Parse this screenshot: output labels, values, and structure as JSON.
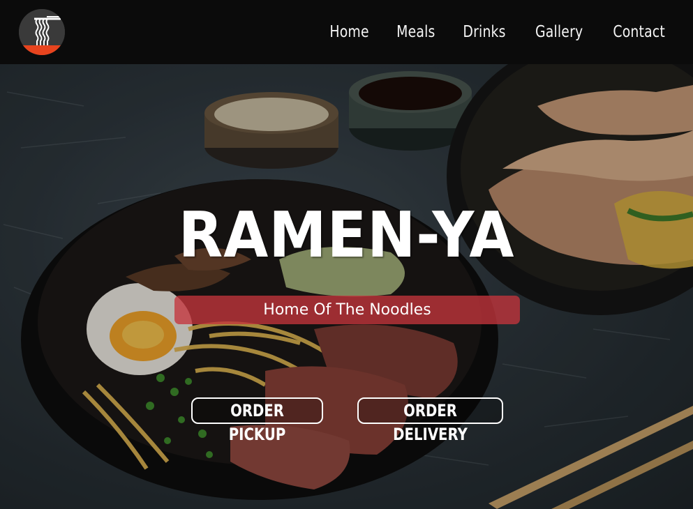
{
  "nav": {
    "logo_icon": "ramen-noodles-icon",
    "links": [
      {
        "label": "Home"
      },
      {
        "label": "Meals"
      },
      {
        "label": "Drinks"
      },
      {
        "label": "Gallery"
      },
      {
        "label": "Contact"
      }
    ]
  },
  "hero": {
    "title": "RAMEN-YA",
    "tagline": "Home Of The Noodles",
    "buttons": {
      "pickup": "ORDER PICKUP",
      "delivery": "ORDER DELIVERY"
    }
  },
  "colors": {
    "navbar": "#0b0b0b",
    "accent_red": "#c4343c",
    "logo_orange": "#e8441e",
    "text": "#ffffff"
  }
}
